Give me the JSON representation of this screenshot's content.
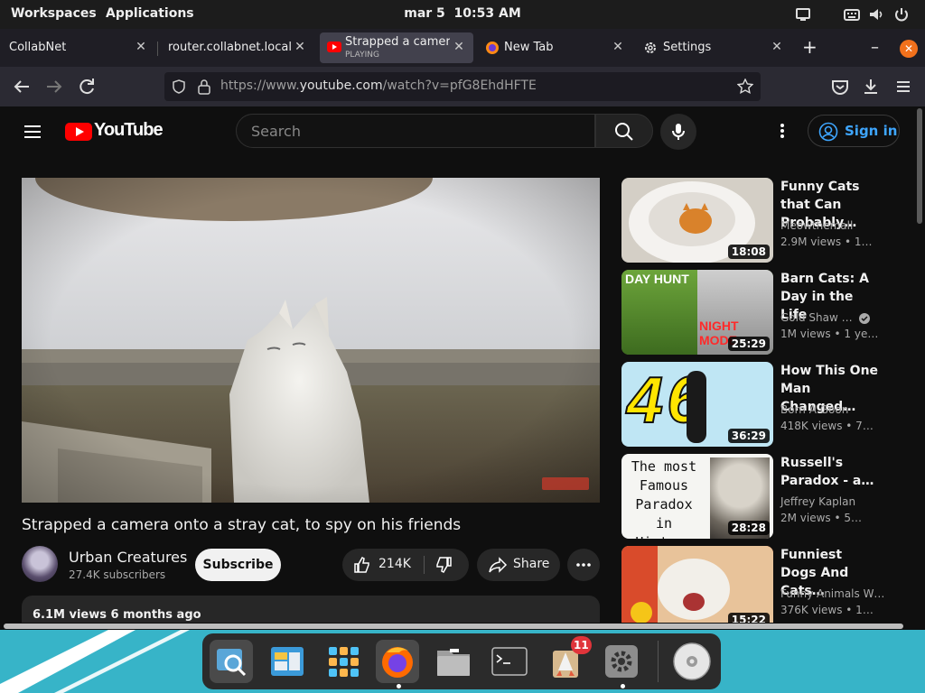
{
  "topbar": {
    "workspaces": "Workspaces",
    "applications": "Applications",
    "date": "mar 5",
    "time": "10:53 AM"
  },
  "browser": {
    "tabs": [
      {
        "title": "CollabNet",
        "active": false
      },
      {
        "title": "router.collabnet.local/a",
        "active": false
      },
      {
        "title": "Strapped a camera",
        "subtitle": "PLAYING",
        "active": true
      },
      {
        "title": "New Tab",
        "active": false
      },
      {
        "title": "Settings",
        "active": false
      }
    ],
    "url_prefix": "https://www.",
    "url_domain": "youtube.com",
    "url_path": "/watch?v=pfG8EhdHFTE"
  },
  "youtube": {
    "logo_text": "YouTube",
    "search_placeholder": "Search",
    "signin_label": "Sign in",
    "video": {
      "title": "Strapped a camera onto a stray cat, to spy on his friends",
      "channel": "Urban Creatures",
      "subscribers": "27.4K subscribers",
      "subscribe_label": "Subscribe",
      "likes": "214K",
      "share_label": "Share",
      "views_date": "6.1M views  6 months ago"
    },
    "recommendations": [
      {
        "title": "Funny Cats that Can Probably…",
        "channel": "Meowthemall",
        "meta": "2.9M views  • 1…",
        "duration": "18:08"
      },
      {
        "title": "Barn Cats: A Day in the Life",
        "channel": "Gold Shaw …",
        "meta": "1M views  • 1 ye…",
        "duration": "25:29",
        "verified": true,
        "thumb_text_1": "DAY HUNT",
        "thumb_text_2": "NIGHT MODE"
      },
      {
        "title": "How This One Man Changed…",
        "channel": "Born A Goon",
        "meta": "418K views  • 7…",
        "duration": "36:29",
        "thumb_text": "46"
      },
      {
        "title": "Russell's Paradox - a…",
        "channel": "Jeffrey Kaplan",
        "meta": "2M views  • 5…",
        "duration": "28:28",
        "thumb_text": "The most Famous Paradox in History"
      },
      {
        "title": "Funniest Dogs And Cats…",
        "channel": "Funny Animals W…",
        "meta": "376K views  • 1…",
        "duration": "15:22"
      }
    ]
  },
  "dock": {
    "items": [
      "search-app",
      "file-manager",
      "app-grid",
      "firefox",
      "files",
      "terminal",
      "software-updates",
      "settings",
      "disk"
    ],
    "update_badge": "11"
  },
  "colors": {
    "accent_red": "#ff0000",
    "link_blue": "#3ea6ff",
    "desktop": "#37b4c8"
  }
}
